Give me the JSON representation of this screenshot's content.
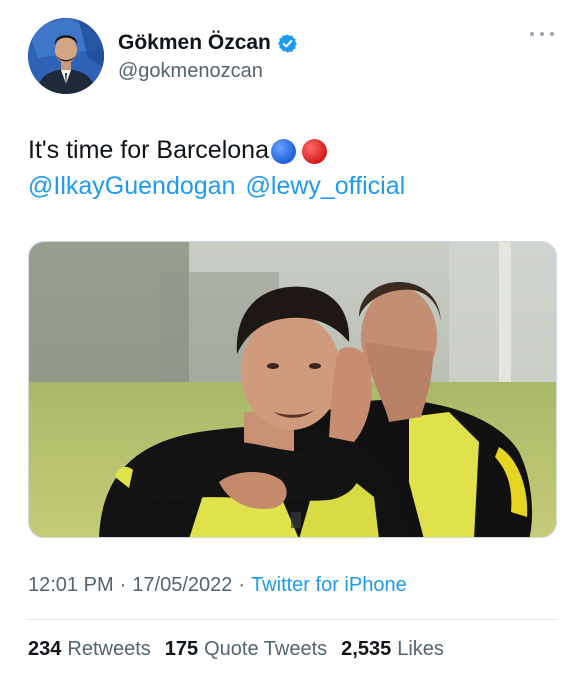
{
  "tweet": {
    "author": {
      "display_name": "Gökmen Özcan",
      "handle": "@gokmenozcan",
      "verified": true
    },
    "text": "It's time for Barcelona",
    "emojis": [
      "blue-circle-icon",
      "red-circle-icon"
    ],
    "mentions": [
      "@IlkayGuendogan",
      "@lewy_official"
    ],
    "time": "12:01 PM",
    "date": "17/05/2022",
    "source": "Twitter for iPhone",
    "separator": "·",
    "stats": {
      "retweets": {
        "count": "234",
        "label": "Retweets"
      },
      "quote_tweets": {
        "count": "175",
        "label": "Quote Tweets"
      },
      "likes": {
        "count": "2,535",
        "label": "Likes"
      }
    }
  },
  "colors": {
    "link": "#1d9bf0",
    "secondary_text": "#536471",
    "primary_text": "#0f1419",
    "verified_badge": "#1d9bf0",
    "kit_yellow": "#e6e83a"
  }
}
